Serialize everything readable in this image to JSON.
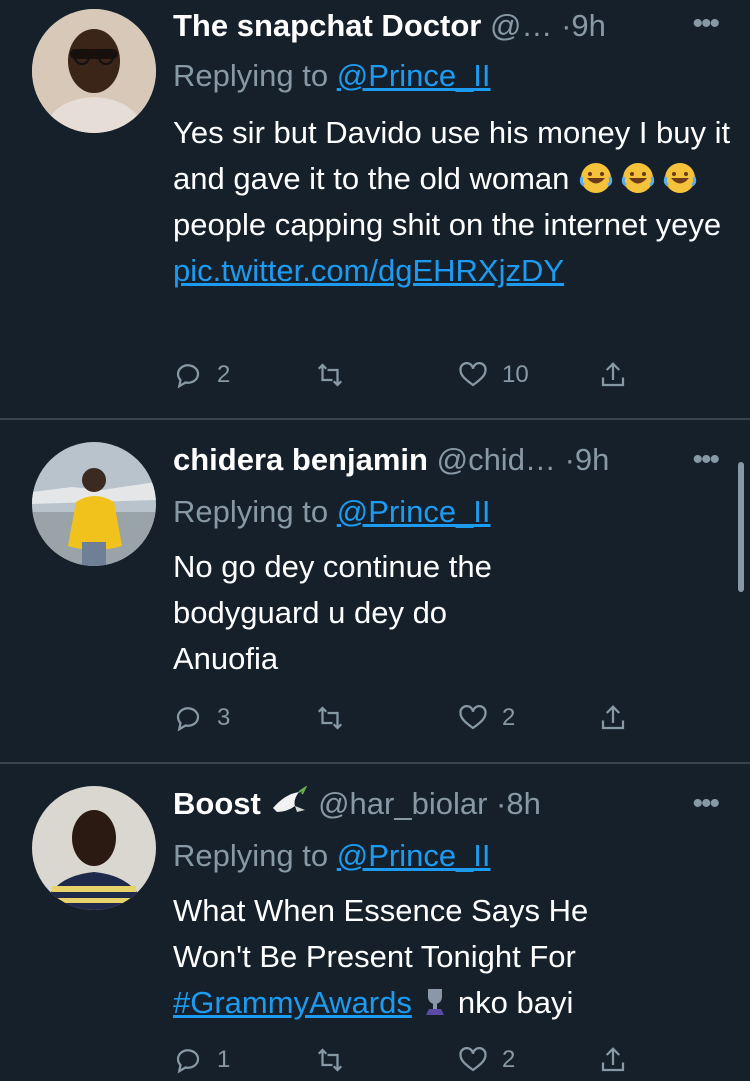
{
  "tweets": [
    {
      "name": "The snapchat Doctor",
      "handle": "@…",
      "dot": "·",
      "time": "9h",
      "replying_prefix": "Replying to",
      "replying_mention": "@Prince_II",
      "text": "Yes sir but Davido use his money I buy it and gave it to the old woman",
      "text_after_emoji": "people capping shit on the internet yeye",
      "link": "pic.twitter.com/dgEHRXjzDY",
      "reply_count": "2",
      "retweet_count": "",
      "like_count": "10"
    },
    {
      "name": "chidera benjamin",
      "handle": "@chid…",
      "dot": "·",
      "time": "9h",
      "replying_prefix": "Replying to",
      "replying_mention": "@Prince_II",
      "text": "No go dey continue the bodyguard u dey do Anuofia",
      "reply_count": "3",
      "retweet_count": "",
      "like_count": "2"
    },
    {
      "name": "Boost",
      "handle": "@har_biolar",
      "dot": "·",
      "time": "8h",
      "replying_prefix": "Replying to",
      "replying_mention": "@Prince_II",
      "text_before": "What When Essence Says He Won't Be Present Tonight For",
      "hashtag": "#GrammyAwards",
      "text_after": "nko bayi",
      "reply_count": "1",
      "retweet_count": "",
      "like_count": "2"
    }
  ],
  "more_label": "•••",
  "colors": {
    "background": "#15202b",
    "secondary_text": "#8899a6",
    "link": "#1d9bf0",
    "divider": "#38444d"
  }
}
